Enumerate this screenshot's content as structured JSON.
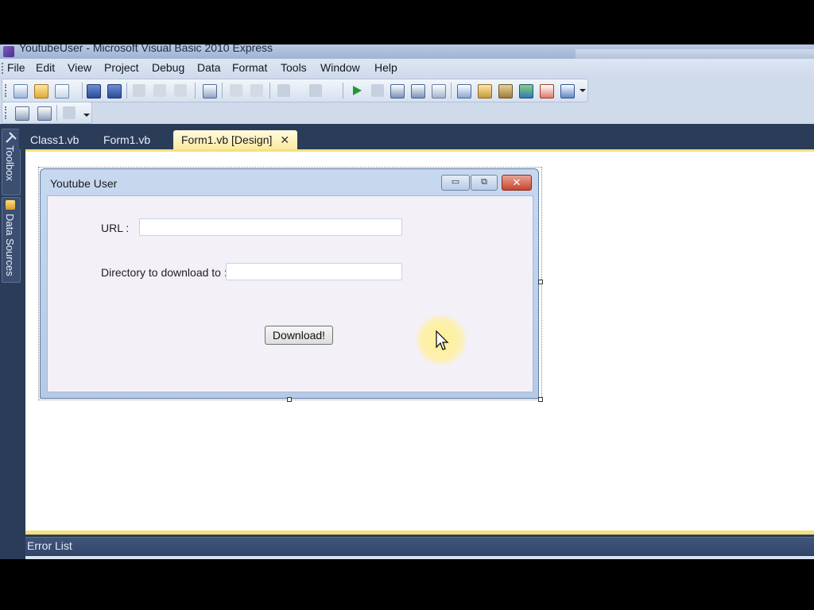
{
  "window": {
    "title": "YoutubeUser - Microsoft Visual Basic 2010 Express"
  },
  "menu": {
    "items": [
      "File",
      "Edit",
      "View",
      "Project",
      "Debug",
      "Data",
      "Format",
      "Tools",
      "Window",
      "Help"
    ]
  },
  "toolbar": {
    "standard_icons": [
      "new-project-icon",
      "open-file-icon",
      "add-item-icon",
      "save-icon",
      "save-all-icon",
      "cut-icon",
      "copy-icon",
      "paste-icon",
      "find-icon",
      "comment-icon",
      "uncomment-icon",
      "undo-icon",
      "redo-icon",
      "start-debugging-icon",
      "stop-icon",
      "step-into-icon",
      "step-over-icon",
      "step-out-icon",
      "solution-explorer-icon",
      "properties-icon",
      "object-browser-icon",
      "toolbox-icon",
      "extension-manager-icon",
      "start-page-icon"
    ],
    "layout_icons": [
      "align-left-icon",
      "align-center-icon",
      "tab-order-icon"
    ]
  },
  "side_panels": {
    "toolbox_label": "Toolbox",
    "data_sources_label": "Data Sources"
  },
  "doc_tabs": {
    "tabs": [
      {
        "label": "Class1.vb",
        "active": false
      },
      {
        "label": "Form1.vb",
        "active": false
      },
      {
        "label": "Form1.vb [Design]",
        "active": true
      }
    ],
    "close_glyph": "✕"
  },
  "form": {
    "title": "Youtube User",
    "url_label": "URL :",
    "url_value": "",
    "directory_label": "Directory to download to :",
    "directory_value": "",
    "download_button": "Download!",
    "min_glyph": "▭",
    "max_glyph": "⧉",
    "close_glyph": "✕"
  },
  "bottom_panel": {
    "label": "Error List"
  },
  "colors": {
    "ide_background": "#2b3c59",
    "active_tab": "#fbe9a0",
    "form_client": "#f4f0f8",
    "cursor_highlight": "#fff08c"
  }
}
